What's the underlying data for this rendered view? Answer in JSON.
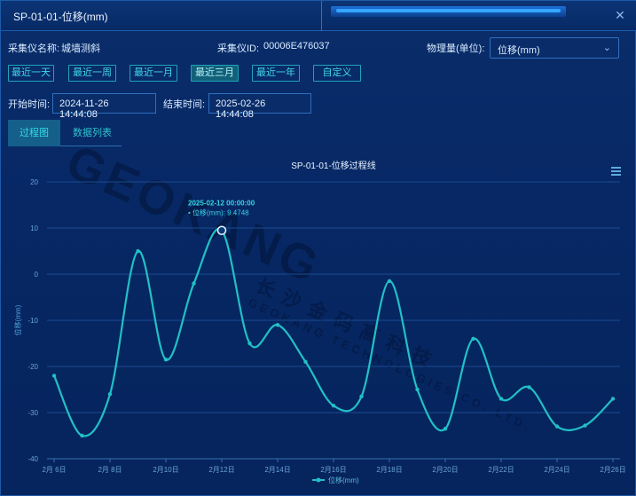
{
  "window": {
    "title": "SP-01-01-位移(mm)",
    "close_icon": "close-icon"
  },
  "info": {
    "collector_name_label": "采集仪名称:",
    "collector_name_value": "城墙测斜",
    "collector_id_label": "采集仪ID:",
    "collector_id_value": "00006E476037",
    "quantity_label": "物理量(单位):",
    "quantity_value": "位移(mm)"
  },
  "range_buttons": [
    "最近一天",
    "最近一周",
    "最近一月",
    "最近三月",
    "最近一年",
    "自定义"
  ],
  "active_range": "最近三月",
  "time": {
    "start_label": "开始时间:",
    "start_value": "2024-11-26 14:44:08",
    "end_label": "结束时间:",
    "end_value": "2025-02-26 14:44:08"
  },
  "tabs": [
    "过程图",
    "数据列表"
  ],
  "active_tab": "过程图",
  "watermark": {
    "brand": "GEOKANG",
    "cn": "长沙金码高科技",
    "en": "GEOKANG TECHNOLOGIES CO.,LTD."
  },
  "colors": {
    "accent": "#22c0c6",
    "background": "#072865",
    "grid": "#1a4c90"
  },
  "chart_data": {
    "type": "line",
    "title": "SP-01-01-位移过程线",
    "ylabel": "位移(mm)",
    "xlabel": "",
    "ylim": [
      -40,
      20
    ],
    "yticks": [
      20,
      10,
      0,
      -10,
      -20,
      -30,
      -40
    ],
    "x_ticks": [
      "2月 6日",
      "2月 8日",
      "2月10日",
      "2月12日",
      "2月14日",
      "2月16日",
      "2月18日",
      "2月20日",
      "2月22日",
      "2月24日",
      "2月26日"
    ],
    "series": [
      {
        "name": "位移(mm)",
        "x": [
          0,
          1,
          2,
          3,
          4,
          5,
          6,
          7,
          8,
          9,
          10,
          11,
          12,
          13,
          14,
          15,
          16,
          17,
          18,
          19,
          20
        ],
        "values": [
          -22,
          -35,
          -26,
          5,
          -18.5,
          -2,
          9.4748,
          -15,
          -11,
          -19,
          -28.5,
          -26.5,
          -1.5,
          -25,
          -33.5,
          -14,
          -27,
          -24.5,
          -33,
          -32.8,
          -27
        ]
      }
    ],
    "tooltip": {
      "date": "2025-02-12 00:00:00",
      "series": "位移(mm)",
      "value": "9.4748",
      "index": 6
    },
    "legend": {
      "label": "位移(mm)",
      "position": "bottom"
    },
    "menu_icon": "hamburger-icon"
  }
}
